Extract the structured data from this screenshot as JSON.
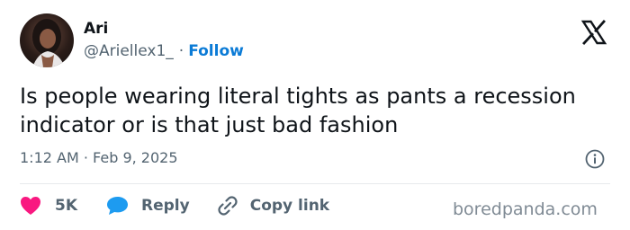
{
  "author": {
    "name": "Ari",
    "handle": "@Ariellex1_",
    "separator": "·",
    "follow_label": "Follow"
  },
  "tweet": {
    "text": "Is people wearing literal tights as pants a recession indicator or is that just bad fashion",
    "timestamp": "1:12 AM · Feb 9, 2025"
  },
  "actions": {
    "likes": "5K",
    "reply_label": "Reply",
    "copy_link_label": "Copy link"
  },
  "icons": {
    "platform_logo": "x-logo-icon",
    "info": "info-icon",
    "like": "heart-icon",
    "reply": "speech-bubble-icon",
    "copy_link": "link-icon"
  },
  "colors": {
    "like": "#f91880",
    "reply": "#1d9bf0",
    "follow": "#0b7bd6",
    "secondary_text": "#536471"
  },
  "watermark": "boredpanda.com"
}
